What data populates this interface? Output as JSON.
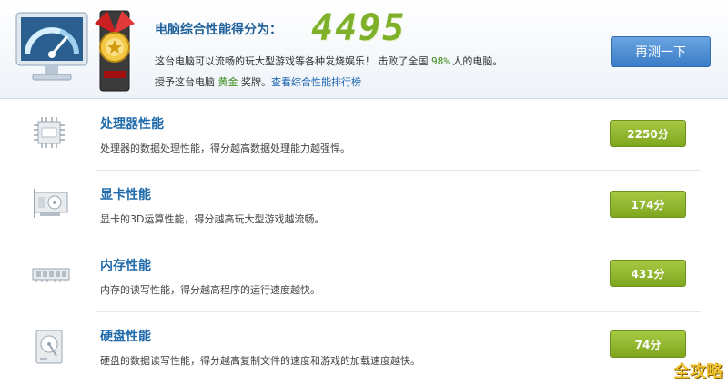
{
  "header": {
    "score_title": "电脑综合性能得分为：",
    "score_value": "4495",
    "desc_before": "这台电脑可以流畅的玩大型游戏等各种发烧娱乐！ 击败了全国 ",
    "percent": "98%",
    "desc_after": " 人的电脑。",
    "award_before": "授予这台电脑 ",
    "medal": "黄金",
    "award_middle": " 奖牌。",
    "rank_link": "查看综合性能排行榜",
    "retest_button": "再测一下",
    "icons": {
      "monitor": "speedometer-monitor-icon",
      "trophy": "gold-medal-icon"
    }
  },
  "rows": [
    {
      "title": "处理器性能",
      "desc": "处理器的数据处理性能，得分越高数据处理能力越强悍。",
      "score": "2250分",
      "icon": "cpu-icon"
    },
    {
      "title": "显卡性能",
      "desc": "显卡的3D运算性能，得分越高玩大型游戏越流畅。",
      "score": "174分",
      "icon": "graphics-card-icon"
    },
    {
      "title": "内存性能",
      "desc": "内存的读写性能，得分越高程序的运行速度越快。",
      "score": "431分",
      "icon": "memory-icon"
    },
    {
      "title": "硬盘性能",
      "desc": "硬盘的数据读写性能，得分越高复制文件的速度和游戏的加载速度越快。",
      "score": "74分",
      "icon": "hard-disk-icon"
    }
  ],
  "watermark": "全攻略",
  "colors": {
    "score_green": "#7fb02a",
    "badge_green": "#8fb52f",
    "button_blue": "#4a8cd4",
    "title_blue": "#1f6aaa"
  }
}
